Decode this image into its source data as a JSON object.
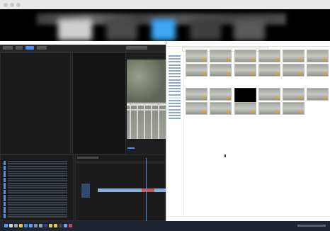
{
  "window": {
    "title_bar": {
      "buttons": [
        "close",
        "minimize",
        "zoom"
      ]
    }
  },
  "colors": {
    "accent": "#3ea7f5",
    "premiere_bg": "#1e1e1e",
    "explorer_bg": "#ffffff",
    "timeline_clip": "#8ab0e0",
    "playhead": "#4c8ef5",
    "taskbar": "#1f2530"
  },
  "premiere": {
    "video_preview": "video-preview",
    "bin_rows": 24
  },
  "explorer": {
    "thumbnails": [
      {
        "dark": false
      },
      {
        "dark": false
      },
      {
        "dark": false
      },
      {
        "dark": false
      },
      {
        "dark": false
      },
      {
        "dark": false
      },
      {
        "dark": false
      },
      {
        "dark": false
      },
      {
        "dark": false
      },
      {
        "dark": false
      },
      {
        "dark": false
      },
      {
        "dark": false
      },
      {
        "dark": false
      },
      {
        "dark": false
      },
      {
        "dark": true
      },
      {
        "dark": false
      },
      {
        "dark": false
      },
      {
        "dark": false
      },
      {
        "dark": false
      },
      {
        "dark": false
      },
      {
        "dark": false
      },
      {
        "dark": false
      },
      {
        "dark": false
      }
    ]
  },
  "taskbar": {
    "icons": [
      "start-icon",
      "search-icon",
      "task-view-icon",
      "explorer-icon",
      "browser-icon",
      "mail-icon",
      "store-icon",
      "settings-icon",
      "premiere-icon",
      "media-icon",
      "folder-icon",
      "terminal-icon",
      "chat-icon",
      "app-icon"
    ]
  }
}
